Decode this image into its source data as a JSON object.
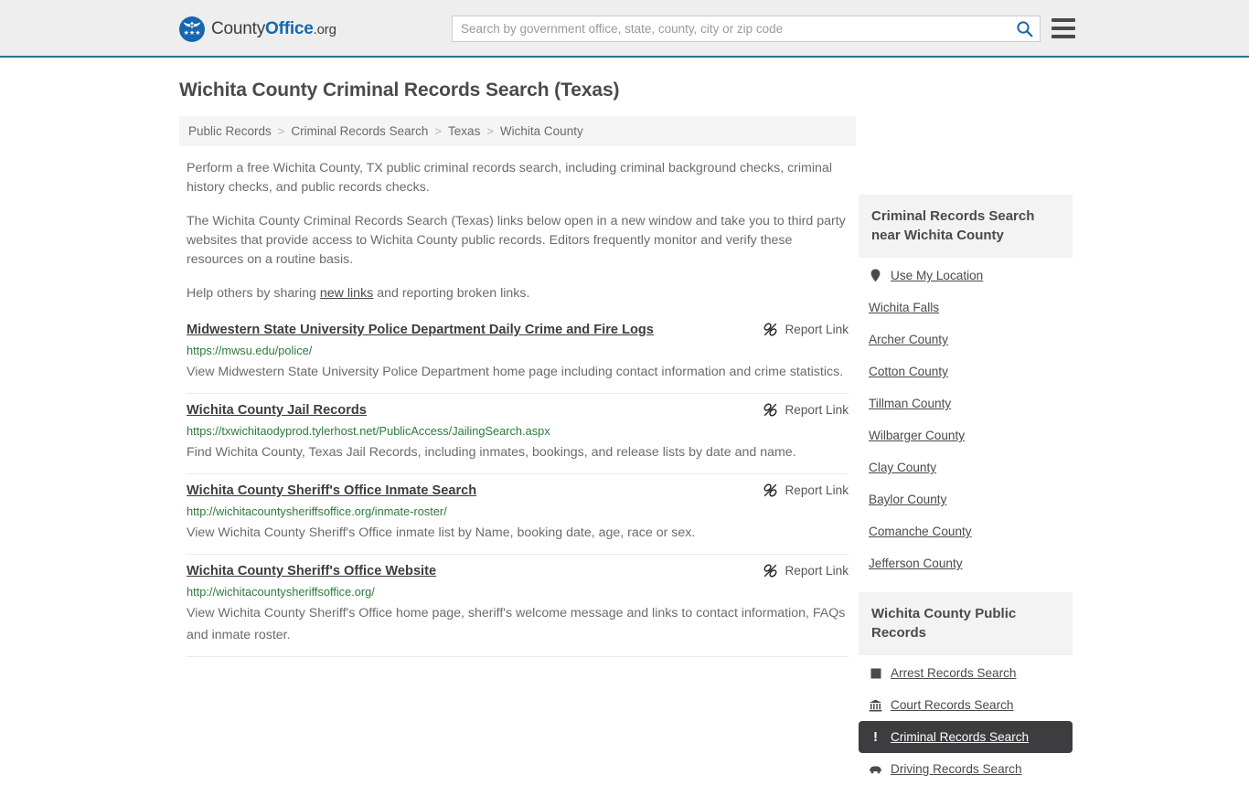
{
  "header": {
    "brand": {
      "part1": "County",
      "part2": "Office",
      "part3": ".org",
      "icon": "eagle-seal-logo"
    },
    "search": {
      "placeholder": "Search by government office, state, county, city or zip code",
      "value": "",
      "search_icon": "search-icon",
      "accent": "#1667b0"
    },
    "menu_icon": "hamburger-menu-icon"
  },
  "page": {
    "title": "Wichita County Criminal Records Search (Texas)"
  },
  "breadcrumb": {
    "separator": ">",
    "items": [
      {
        "label": "Public Records"
      },
      {
        "label": "Criminal Records Search"
      },
      {
        "label": "Texas"
      },
      {
        "label": "Wichita County"
      }
    ]
  },
  "intro": {
    "p1": "Perform a free Wichita County, TX public criminal records search, including criminal background checks, criminal history checks, and public records checks.",
    "p2": "The Wichita County Criminal Records Search (Texas) links below open in a new window and take you to third party websites that provide access to Wichita County public records. Editors frequently monitor and verify these resources on a routine basis.",
    "p3_before": "Help others by sharing ",
    "p3_link": "new links",
    "p3_after": " and reporting broken links."
  },
  "results": {
    "report_label": "Report Link",
    "report_icon": "broken-link-icon",
    "items": [
      {
        "title": "Midwestern State University Police Department Daily Crime and Fire Logs",
        "url": "https://mwsu.edu/police/",
        "description": "View Midwestern State University Police Department home page including contact information and crime statistics."
      },
      {
        "title": "Wichita County Jail Records",
        "url": "https://txwichitaodyprod.tylerhost.net/PublicAccess/JailingSearch.aspx",
        "description": "Find Wichita County, Texas Jail Records, including inmates, bookings, and release lists by date and name."
      },
      {
        "title": "Wichita County Sheriff's Office Inmate Search",
        "url": "http://wichitacountysheriffsoffice.org/inmate-roster/",
        "description": "View Wichita County Sheriff's Office inmate list by Name, booking date, age, race or sex."
      },
      {
        "title": "Wichita County Sheriff's Office Website",
        "url": "http://wichitacountysheriffsoffice.org/",
        "description": "View Wichita County Sheriff's Office home page, sheriff's welcome message and links to contact information, FAQs and inmate roster."
      }
    ]
  },
  "sidebar": {
    "nearby": {
      "heading": "Criminal Records Search near Wichita County",
      "items": [
        {
          "label": "Use My Location",
          "icon": "map-pin-icon"
        },
        {
          "label": "Wichita Falls",
          "icon": ""
        },
        {
          "label": "Archer County",
          "icon": ""
        },
        {
          "label": "Cotton County",
          "icon": ""
        },
        {
          "label": "Tillman County",
          "icon": ""
        },
        {
          "label": "Wilbarger County",
          "icon": ""
        },
        {
          "label": "Clay County",
          "icon": ""
        },
        {
          "label": "Baylor County",
          "icon": ""
        },
        {
          "label": "Comanche County",
          "icon": ""
        },
        {
          "label": "Jefferson County",
          "icon": ""
        }
      ]
    },
    "public_records": {
      "heading": "Wichita County Public Records",
      "items": [
        {
          "label": "Arrest Records Search",
          "icon": "fingerprint-square-icon",
          "active": false
        },
        {
          "label": "Court Records Search",
          "icon": "courthouse-icon",
          "active": false
        },
        {
          "label": "Criminal Records Search",
          "icon": "exclamation-icon",
          "active": true
        },
        {
          "label": "Driving Records Search",
          "icon": "car-icon",
          "active": false
        }
      ],
      "active_bg": "#3d3d3f"
    }
  }
}
